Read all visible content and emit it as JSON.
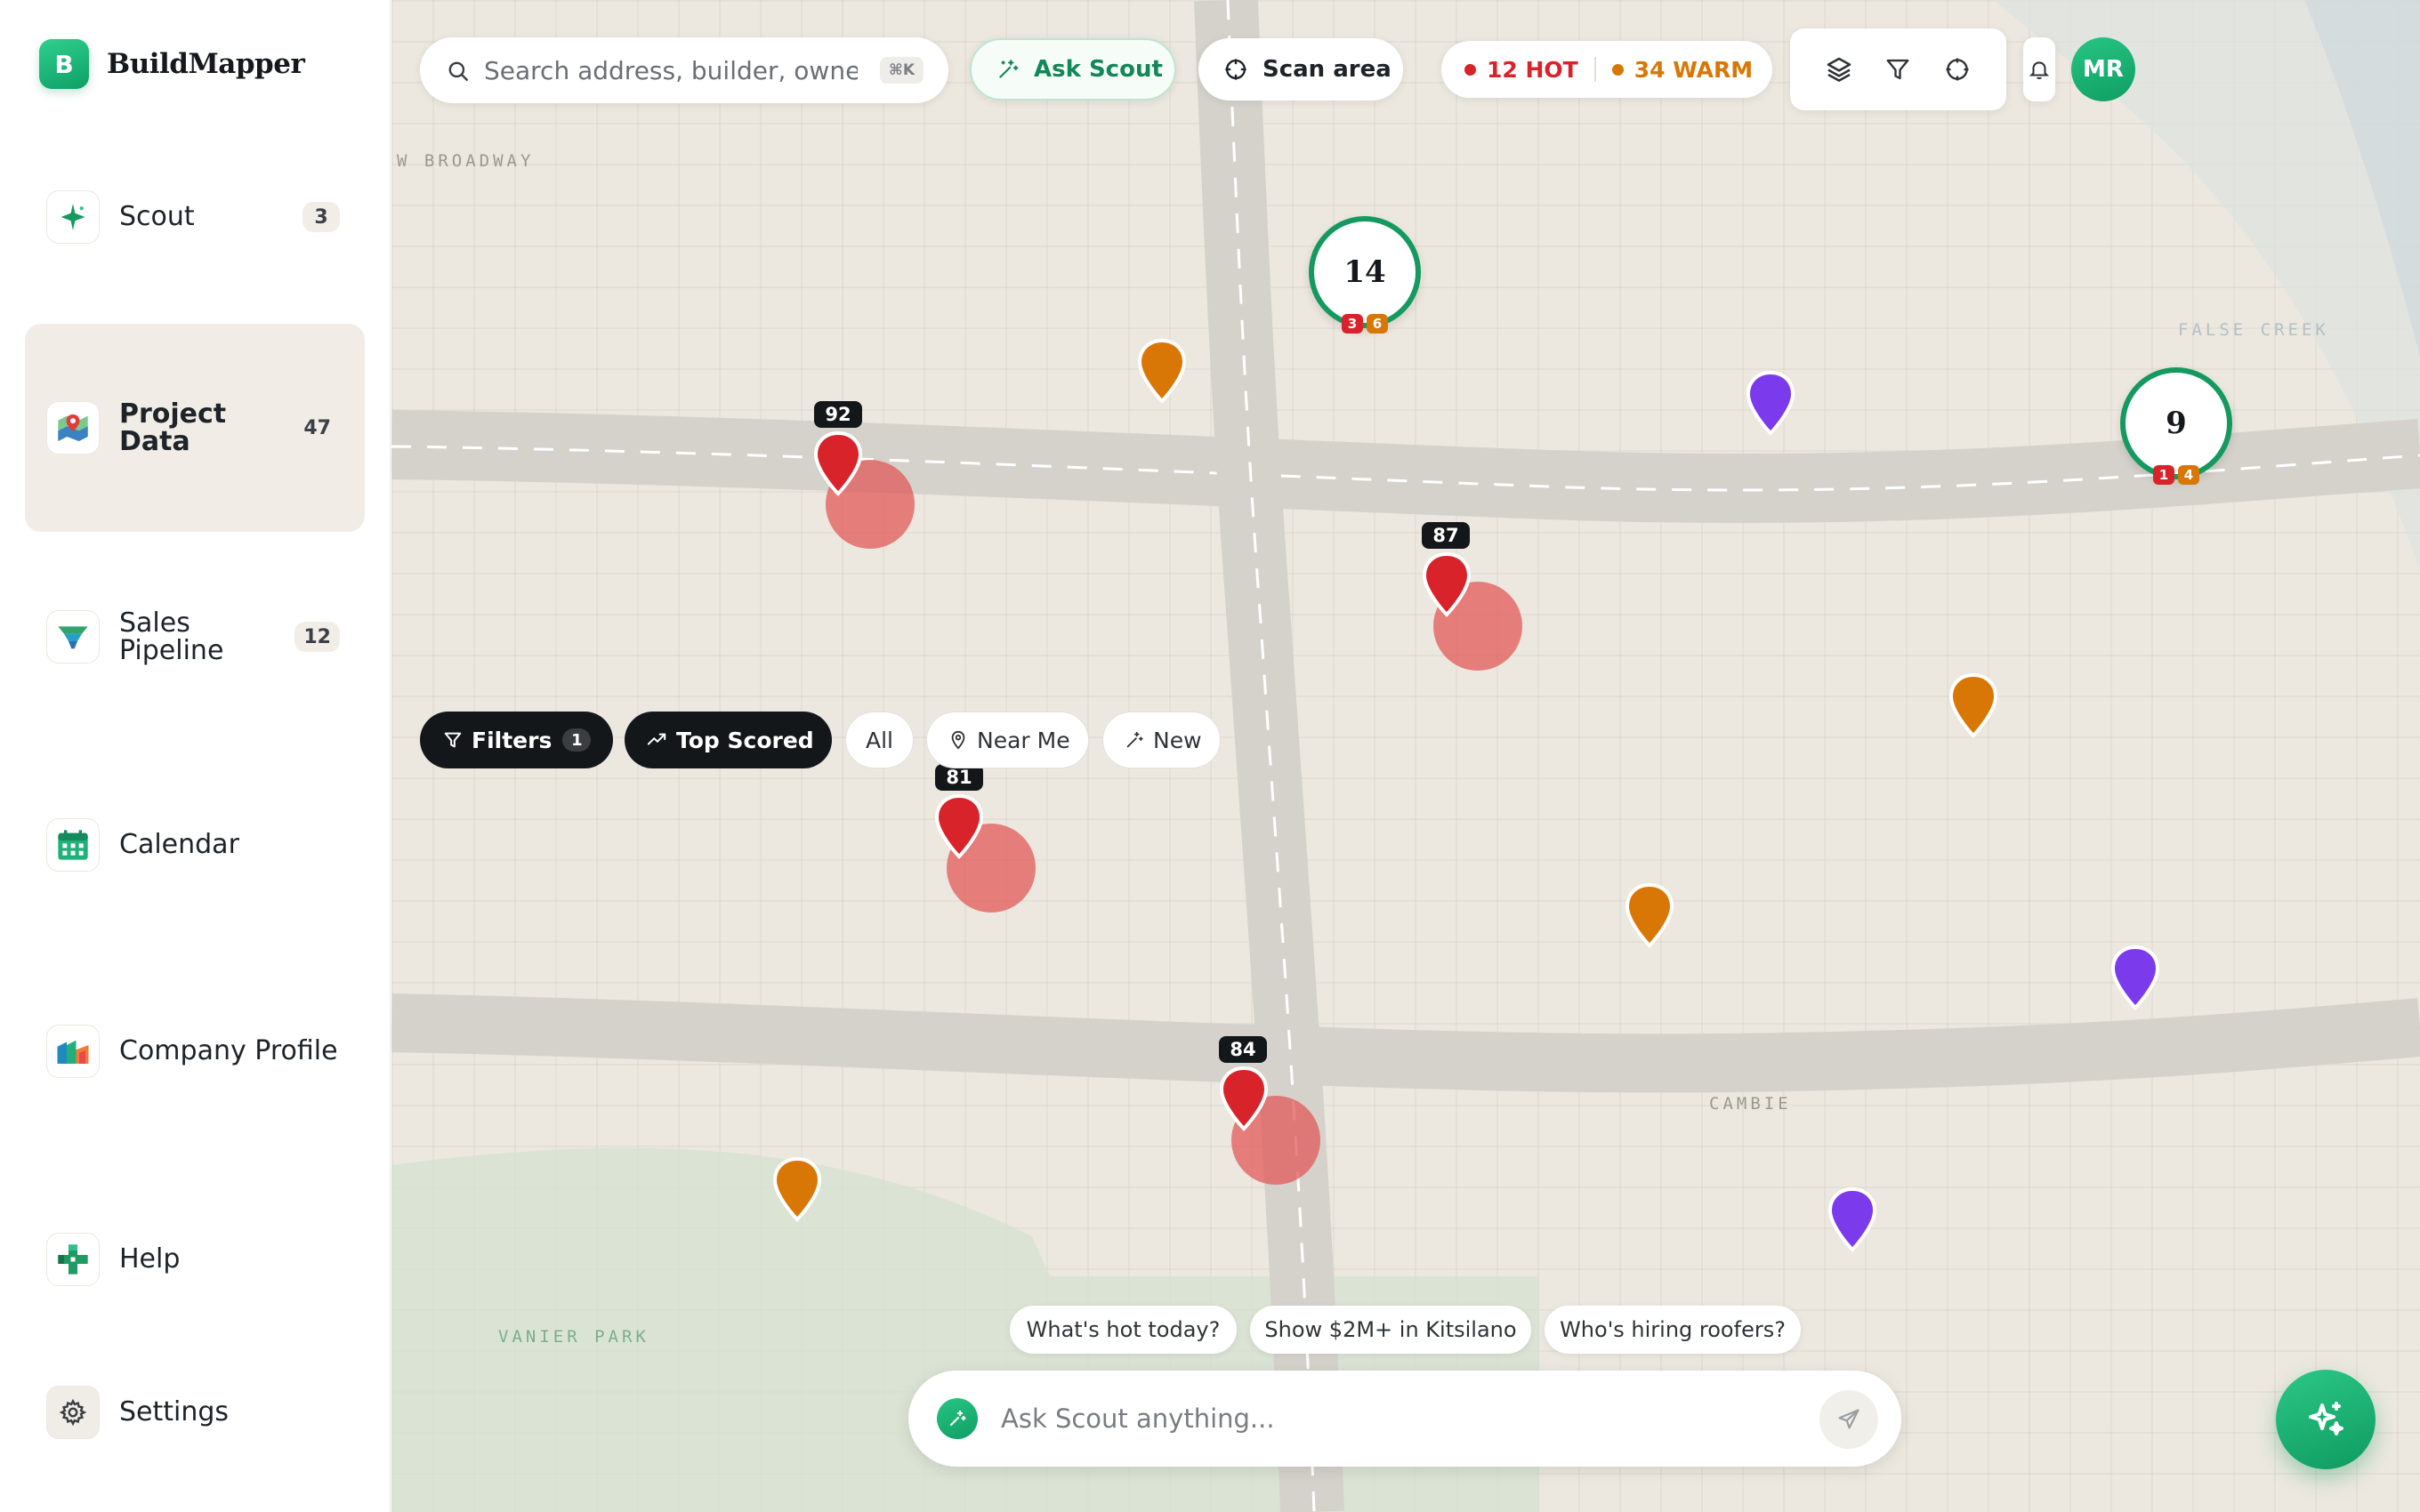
{
  "brand": {
    "name": "BuildMapper",
    "logo_letter": "B"
  },
  "sidebar": {
    "items": [
      {
        "label": "Scout",
        "badge": "3",
        "icon": "sparkle-icon"
      },
      {
        "label": "Project Data",
        "badge": "47",
        "icon": "map-pin-icon",
        "active": true
      },
      {
        "label": "Sales Pipeline",
        "badge": "12",
        "icon": "funnel-icon"
      },
      {
        "label": "Calendar",
        "badge": "",
        "icon": "calendar-icon"
      },
      {
        "label": "Company Profile",
        "badge": "",
        "icon": "company-chart-icon"
      },
      {
        "label": "Help",
        "badge": "",
        "icon": "help-icon"
      },
      {
        "label": "Settings",
        "badge": "",
        "icon": "gear-icon"
      }
    ]
  },
  "topbar": {
    "search_placeholder": "Search address, builder, owner...",
    "search_shortcut": "⌘K",
    "ask_scout_label": "Ask Scout",
    "scan_area_label": "Scan area",
    "hot_label": "12 HOT",
    "warm_label": "34 WARM",
    "avatar_initials": "MR"
  },
  "map": {
    "labels": {
      "broadway": "W BROADWAY",
      "false_creek": "FALSE CREEK",
      "cambie": "CAMBIE",
      "vanier_park": "VANIER PARK"
    },
    "scores": [
      "92",
      "87",
      "81",
      "84"
    ],
    "clusters": [
      {
        "count": "14",
        "hot": "3",
        "warm": "6"
      },
      {
        "count": "9",
        "hot": "1",
        "warm": "4"
      }
    ]
  },
  "filters": {
    "filters_label": "Filters",
    "filters_count": "1",
    "top_scored_label": "Top Scored",
    "all_label": "All",
    "near_me_label": "Near Me",
    "new_label": "New"
  },
  "assistant": {
    "suggestions": [
      "What's hot today?",
      "Show $2M+ in Kitsilano",
      "Who's hiring roofers?"
    ],
    "placeholder": "Ask Scout anything..."
  },
  "colors": {
    "accent": "#12875a",
    "hot": "#d8232a",
    "warm": "#d97706",
    "purple": "#7c3aed"
  }
}
